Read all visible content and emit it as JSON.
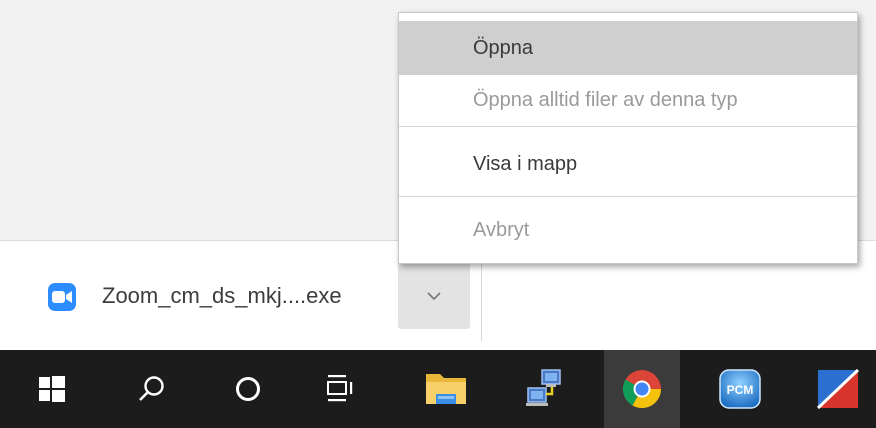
{
  "context_menu": {
    "items": [
      {
        "label": "Öppna",
        "state": "highlighted"
      },
      {
        "label": "Öppna alltid filer av denna typ",
        "state": "disabled"
      },
      {
        "label": "Visa i mapp",
        "state": "enabled"
      },
      {
        "label": "Avbryt",
        "state": "disabled"
      }
    ]
  },
  "download": {
    "file_name": "Zoom_cm_ds_mkj....exe",
    "icon": "zoom-icon"
  },
  "taskbar": {
    "buttons": [
      {
        "name": "start",
        "icon": "windows-logo-icon"
      },
      {
        "name": "search",
        "icon": "search-icon"
      },
      {
        "name": "cortana",
        "icon": "circle-icon"
      },
      {
        "name": "task-view",
        "icon": "task-view-icon"
      },
      {
        "name": "file-explorer",
        "icon": "folder-icon"
      },
      {
        "name": "network",
        "icon": "network-computers-icon"
      },
      {
        "name": "chrome",
        "icon": "chrome-icon",
        "active": true
      },
      {
        "name": "pcm",
        "icon": "pcm-icon",
        "label": "PCM"
      },
      {
        "name": "app",
        "icon": "app-tile-icon"
      }
    ]
  },
  "colors": {
    "menu_highlight": "#cfcfcf",
    "taskbar": "#1c1c1c",
    "zoom_blue": "#2d8cff"
  }
}
